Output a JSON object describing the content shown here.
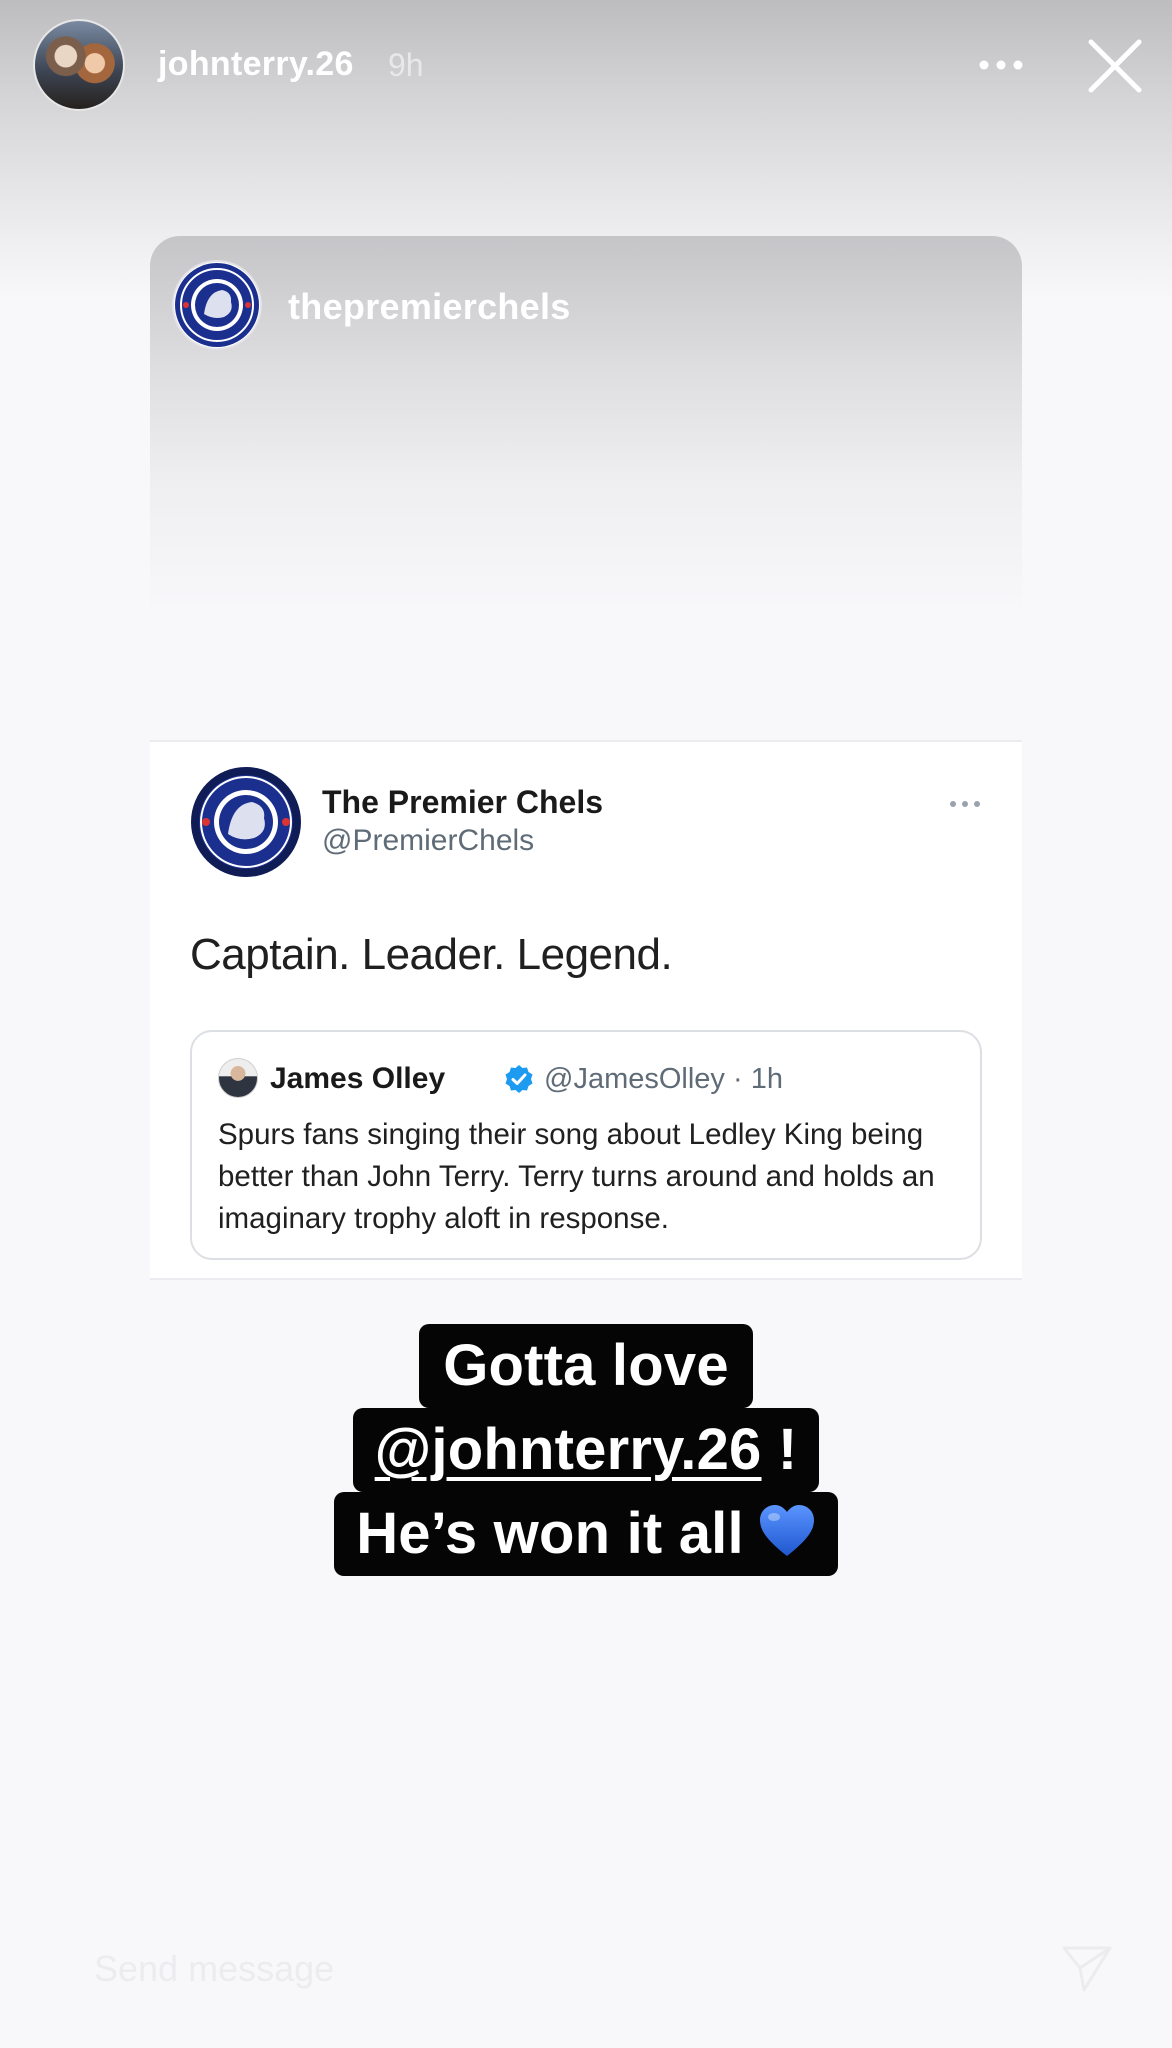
{
  "story": {
    "username": "johnterry.26",
    "time": "9h"
  },
  "repost": {
    "username": "thepremierchels"
  },
  "tweet": {
    "name": "The Premier Chels",
    "handle": "@PremierChels",
    "text": "Captain. Leader. Legend.",
    "quote": {
      "name": "James Olley",
      "handle": "@JamesOlley · 1h",
      "body": "Spurs fans singing their song about Ledley King being better than John Terry. Terry turns around and holds an imaginary trophy aloft in response."
    }
  },
  "caption": {
    "line1": "Gotta love",
    "mention": "@johnterry.26",
    "line2_suffix": " !",
    "line3": "He’s won it all"
  },
  "reply": {
    "placeholder": "Send message"
  },
  "colors": {
    "verified": "#1d9bf0",
    "chelsea_blue": "#1b2f8f",
    "heart": "#2f6fe0"
  },
  "icons": [
    "more-icon",
    "close-icon",
    "verified-icon",
    "blue-heart-icon",
    "send-icon"
  ]
}
